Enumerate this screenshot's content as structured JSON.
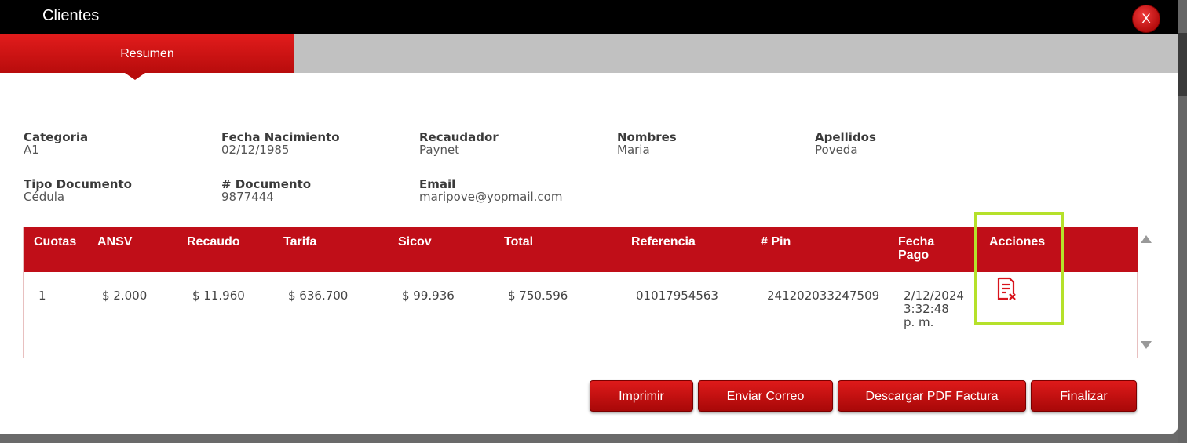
{
  "window": {
    "title": "Clientes",
    "close_label": "X"
  },
  "tabs": [
    {
      "label": "Resumen",
      "active": true
    }
  ],
  "fields": {
    "categoria": {
      "label": "Categoria",
      "value": "A1"
    },
    "fecha_nacimiento": {
      "label": "Fecha Nacimiento",
      "value": "02/12/1985"
    },
    "recaudador": {
      "label": "Recaudador",
      "value": "Paynet"
    },
    "nombres": {
      "label": "Nombres",
      "value": "Maria"
    },
    "apellidos": {
      "label": "Apellidos",
      "value": "Poveda"
    },
    "tipo_documento": {
      "label": "Tipo Documento",
      "value": "Cédula"
    },
    "documento": {
      "label": "# Documento",
      "value": "9877444"
    },
    "email": {
      "label": "Email",
      "value": "maripove@yopmail.com"
    }
  },
  "table": {
    "headers": [
      "Cuotas",
      "ANSV",
      "Recaudo",
      "Tarifa",
      "Sicov",
      "Total",
      "Referencia",
      "# Pin",
      "Fecha\nPago",
      "Acciones"
    ],
    "rows": [
      [
        "1",
        "$ 2.000",
        "$ 11.960",
        "$ 636.700",
        "$ 99.936",
        "$ 750.596",
        "01017954563",
        "241202033247509",
        "2/12/2024\n3:32:48\np. m."
      ]
    ],
    "action_icon": "invoice-cancel-icon"
  },
  "buttons": {
    "imprimir": "Imprimir",
    "enviar_correo": "Enviar Correo",
    "descargar_pdf": "Descargar PDF Factura",
    "finalizar": "Finalizar"
  },
  "colors": {
    "header_red": "#c00e18",
    "title_bar": "#000000",
    "tab_inactive": "#c1c1c1",
    "highlight": "#b5e12a"
  }
}
